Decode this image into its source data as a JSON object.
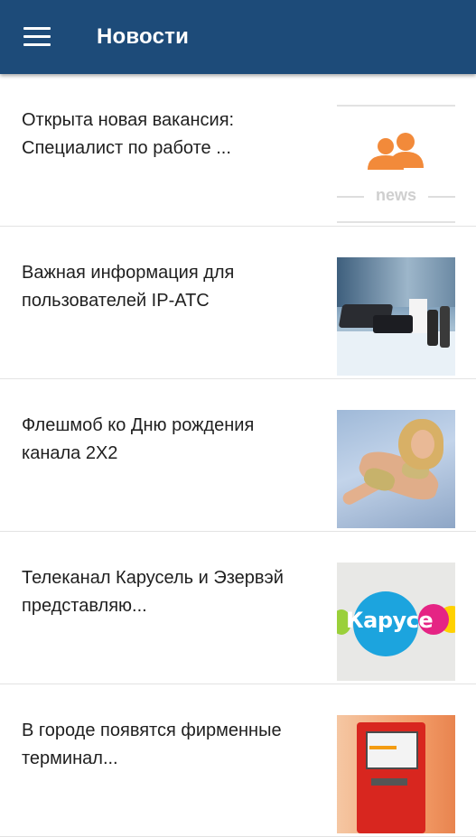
{
  "header": {
    "title": "Новости",
    "menu_icon": "hamburger-menu-icon",
    "background": "#1d4b79"
  },
  "news": [
    {
      "title": "Открыта новая вакансия: Специалист по работе ...",
      "thumb_label": "news",
      "thumb_icon": "people-icon"
    },
    {
      "title": "Важная информация для пользователей IP-ATC"
    },
    {
      "title": "Флешмоб ко Дню рождения канала 2X2"
    },
    {
      "title": "Телеканал Карусель и Эзервэй представляю...",
      "thumb_label": "Карусе"
    },
    {
      "title": "В городе появятся фирменные терминал..."
    }
  ]
}
